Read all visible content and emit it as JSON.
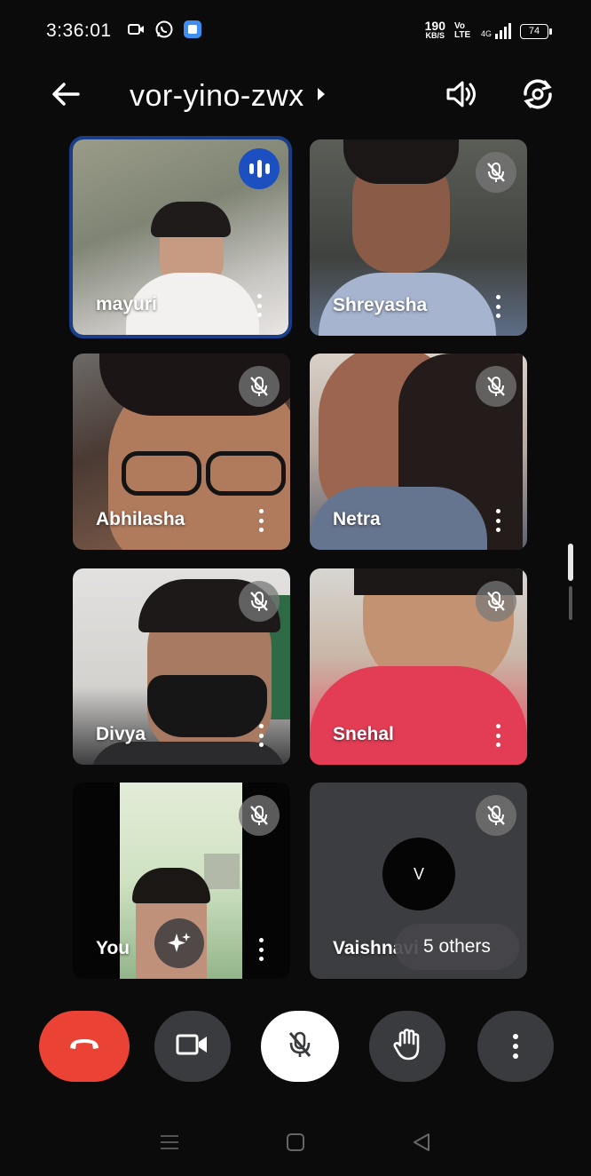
{
  "status_bar": {
    "time": "3:36:01",
    "speed_value": "190",
    "speed_unit": "KB/S",
    "network_label": "Vo LTE",
    "signal_label": "4G",
    "battery": "74"
  },
  "header": {
    "meeting_code": "vor-yino-zwx"
  },
  "participants": [
    {
      "name": "mayuri",
      "state": "speaking"
    },
    {
      "name": "Shreyasha",
      "state": "muted"
    },
    {
      "name": "Abhilasha",
      "state": "muted"
    },
    {
      "name": "Netra",
      "state": "muted"
    },
    {
      "name": "Divya",
      "state": "muted"
    },
    {
      "name": "Snehal",
      "state": "muted"
    },
    {
      "name": "You",
      "state": "muted"
    },
    {
      "name": "Vaishnavi",
      "state": "muted",
      "avatar_letter": "V",
      "others_label": "5 others"
    }
  ],
  "colors": {
    "end_call": "#ea4335",
    "speaking_badge": "#1c4fc0",
    "active_border": "#1a3d8a",
    "control_bg": "#3a3b3e"
  }
}
